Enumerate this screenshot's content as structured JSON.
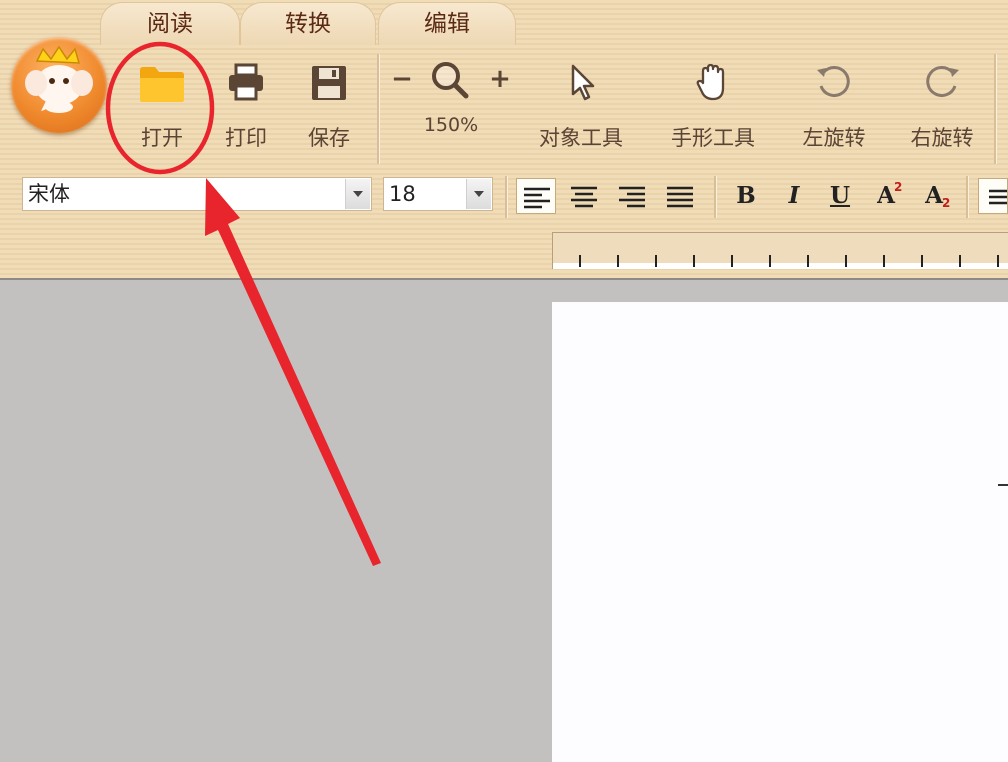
{
  "tabs": [
    {
      "label": "阅读",
      "active": true
    },
    {
      "label": "转换",
      "active": false
    },
    {
      "label": "编辑",
      "active": false
    }
  ],
  "toolbar": {
    "open_label": "打开",
    "print_label": "打印",
    "save_label": "保存",
    "zoom_minus": "−",
    "zoom_plus": "+",
    "zoom_level": "150%",
    "object_tool_label": "对象工具",
    "hand_tool_label": "手形工具",
    "rotate_left_label": "左旋转",
    "rotate_right_label": "右旋转"
  },
  "format": {
    "font_family": "宋体",
    "font_size": "18",
    "bold": "B",
    "italic": "I",
    "underline": "U",
    "superscript": "A",
    "superscript_mark": "2",
    "subscript": "A",
    "subscript_mark": "2"
  },
  "colors": {
    "annotation": "#e8242c",
    "folder": "#f6b21d",
    "logo": "#f08a2e"
  }
}
